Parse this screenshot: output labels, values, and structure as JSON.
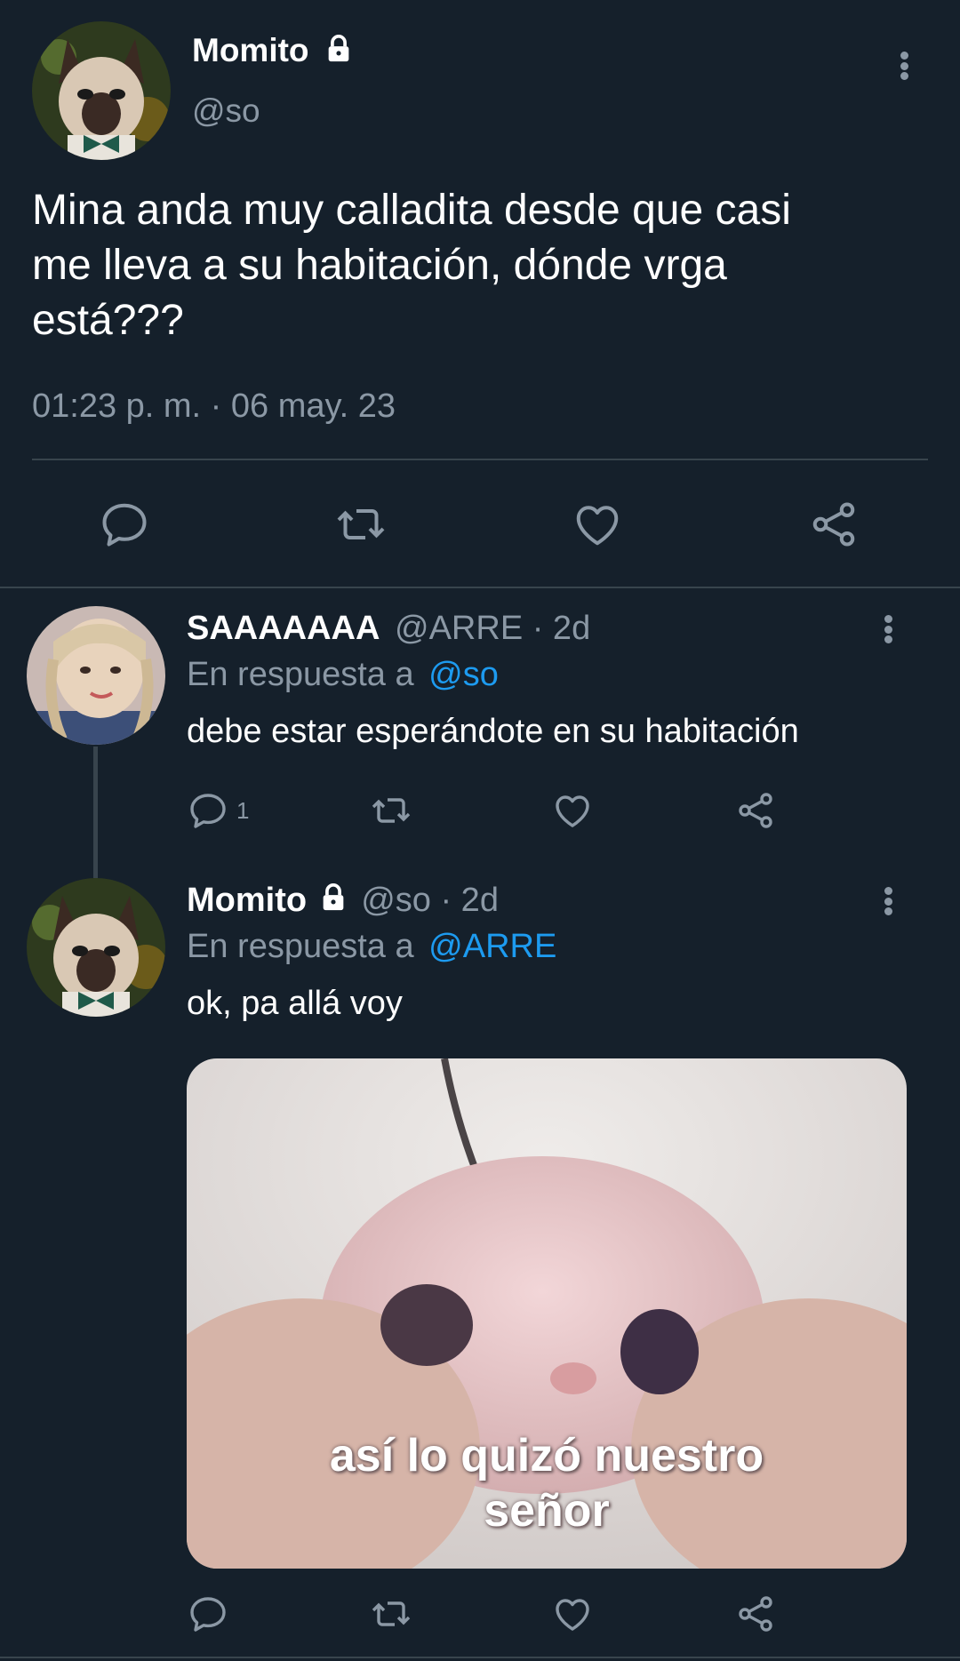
{
  "main_tweet": {
    "display_name": "Momito",
    "handle": "@so",
    "text_lines": [
      "Mina anda muy calladita desde que casi",
      "me lleva a su habitación, dónde vrga",
      "está???"
    ],
    "timestamp": "01:23 p. m. · 06 may. 23"
  },
  "replies": [
    {
      "display_name": "SAAAAAAA",
      "handle_time": "@ARRE · 2d",
      "reply_prefix": "En respuesta a",
      "reply_to": "@so",
      "text": "debe estar esperándote en su habitación",
      "reply_count": "1"
    },
    {
      "display_name": "Momito",
      "handle_time": "@so · 2d",
      "reply_prefix": "En respuesta a",
      "reply_to": "@ARRE",
      "text": "ok, pa allá voy",
      "media_caption_lines": [
        "así lo quizó nuestro",
        "señor"
      ]
    }
  ],
  "icons": {
    "reply": "speech-bubble-icon",
    "retweet": "retweet-icon",
    "like": "heart-icon",
    "share": "share-icon",
    "more": "vertical-dots-icon",
    "lock": "lock-icon"
  },
  "colors": {
    "background": "#15202b",
    "text": "#ffffff",
    "muted": "#8b98a5",
    "link": "#1d9bf0",
    "divider": "#38444d"
  }
}
